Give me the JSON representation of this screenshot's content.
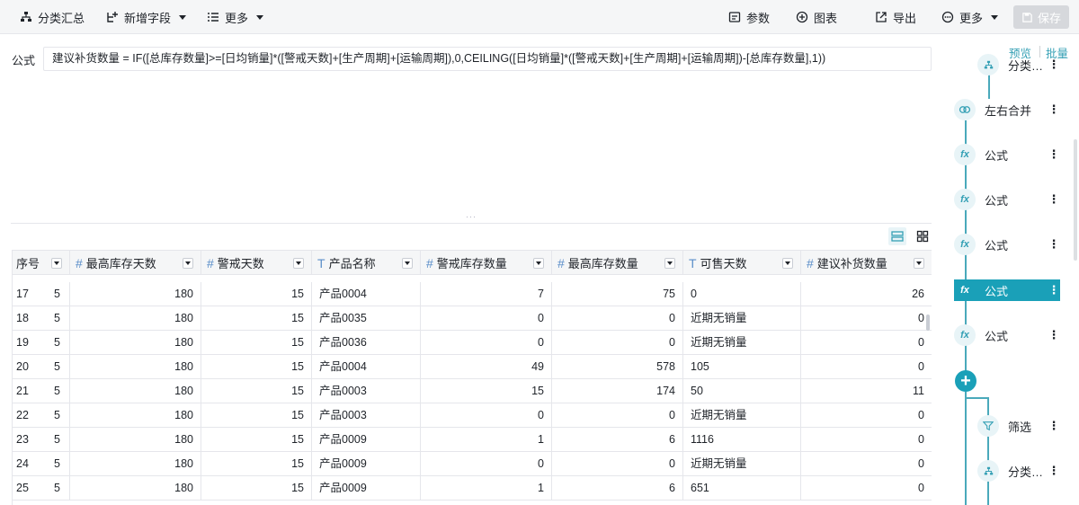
{
  "toolbar": {
    "group_summary": "分类汇总",
    "add_field": "新增字段",
    "more": "更多",
    "params": "参数",
    "chart": "图表",
    "export": "导出",
    "more2": "更多",
    "save": "保存"
  },
  "formula": {
    "label": "公式",
    "text": "建议补货数量 = IF([总库存数量]>=[日均销量]*([警戒天数]+[生产周期]+[运输周期]),0,CEILING([日均销量]*([警戒天数]+[生产周期]+[运输周期])-[总库存数量],1))"
  },
  "table": {
    "columns": [
      {
        "label": "序号",
        "type": ""
      },
      {
        "label": "最高库存天数",
        "type": "#"
      },
      {
        "label": "警戒天数",
        "type": "#"
      },
      {
        "label": "产品名称",
        "type": "T"
      },
      {
        "label": "警戒库存数量",
        "type": "#"
      },
      {
        "label": "最高库存数量",
        "type": "#"
      },
      {
        "label": "可售天数",
        "type": "T"
      },
      {
        "label": "建议补货数量",
        "type": "#"
      }
    ],
    "rows": [
      {
        "seq": "17",
        "v": [
          "5",
          "180",
          "15",
          "产品0004",
          "7",
          "75",
          "0",
          "26"
        ]
      },
      {
        "seq": "18",
        "v": [
          "5",
          "180",
          "15",
          "产品0035",
          "0",
          "0",
          "近期无销量",
          "0"
        ]
      },
      {
        "seq": "19",
        "v": [
          "5",
          "180",
          "15",
          "产品0036",
          "0",
          "0",
          "近期无销量",
          "0"
        ]
      },
      {
        "seq": "20",
        "v": [
          "5",
          "180",
          "15",
          "产品0004",
          "49",
          "578",
          "105",
          "0"
        ]
      },
      {
        "seq": "21",
        "v": [
          "5",
          "180",
          "15",
          "产品0003",
          "15",
          "174",
          "50",
          "11"
        ]
      },
      {
        "seq": "22",
        "v": [
          "5",
          "180",
          "15",
          "产品0003",
          "0",
          "0",
          "近期无销量",
          "0"
        ]
      },
      {
        "seq": "23",
        "v": [
          "5",
          "180",
          "15",
          "产品0009",
          "1",
          "6",
          "1116",
          "0"
        ]
      },
      {
        "seq": "24",
        "v": [
          "5",
          "180",
          "15",
          "产品0009",
          "0",
          "0",
          "近期无销量",
          "0"
        ]
      },
      {
        "seq": "25",
        "v": [
          "5",
          "180",
          "15",
          "产品0009",
          "1",
          "6",
          "651",
          "0"
        ]
      }
    ]
  },
  "panel": {
    "preview": "预览",
    "batch": "批量",
    "steps": [
      {
        "label": "分类…",
        "icon": "summary"
      },
      {
        "label": "左右合并",
        "icon": "merge"
      },
      {
        "label": "公式",
        "icon": "fx"
      },
      {
        "label": "公式",
        "icon": "fx"
      },
      {
        "label": "公式",
        "icon": "fx"
      },
      {
        "label": "公式",
        "icon": "fx",
        "active": true
      },
      {
        "label": "公式",
        "icon": "fx"
      }
    ],
    "branch": [
      {
        "label": "筛选",
        "icon": "filter"
      },
      {
        "label": "分类…",
        "icon": "summary"
      }
    ],
    "more_glyph": "⋮",
    "fx_glyph": "fx",
    "add_glyph": "+"
  },
  "colors": {
    "accent": "#1aa0b8",
    "accent_light": "#e8f4f7",
    "header_bg": "#f5f6f7",
    "border": "#e5e6eb"
  }
}
